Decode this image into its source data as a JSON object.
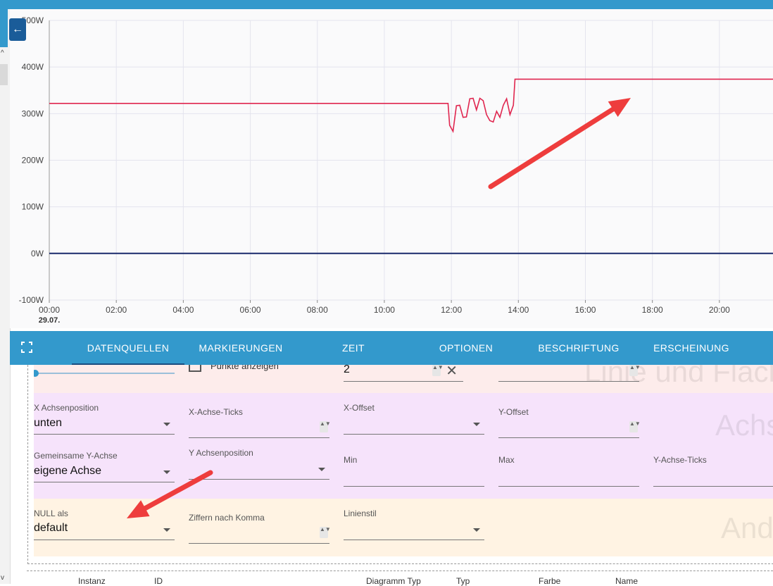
{
  "chart": {
    "y_tick_labels": [
      "500W",
      "400W",
      "300W",
      "200W",
      "100W",
      "0W",
      "-100W"
    ],
    "x_tick_labels": [
      "00:00",
      "02:00",
      "04:00",
      "06:00",
      "08:00",
      "10:00",
      "12:00",
      "14:00",
      "16:00",
      "18:00",
      "20:00"
    ],
    "date_label": "29.07.",
    "series_colors": {
      "power": "#e0264f",
      "zero": "#1a2a6c"
    },
    "annotation_color": "#ee3d3d"
  },
  "chart_data": {
    "type": "line",
    "ylim": [
      -100,
      500
    ],
    "x_unit": "hours since 00:00 on 29.07.",
    "xlim": [
      0,
      21.6
    ],
    "series": [
      {
        "values_x": [
          0,
          11.9,
          11.95,
          12.05,
          12.15,
          12.25,
          12.35,
          12.45,
          12.55,
          12.65,
          12.75,
          12.85,
          12.95,
          13.05,
          13.15,
          13.25,
          13.35,
          13.45,
          13.55,
          13.65,
          13.75,
          13.85,
          13.9,
          21.6
        ],
        "values_y": [
          322,
          322,
          275,
          262,
          317,
          318,
          292,
          293,
          332,
          333,
          308,
          333,
          328,
          298,
          285,
          282,
          305,
          292,
          318,
          332,
          298,
          318,
          374,
          374
        ]
      },
      {
        "values_x": [
          0,
          21.6
        ],
        "values_y": [
          0,
          0
        ]
      }
    ]
  },
  "toolbar": {
    "back_icon": "arrow-left-icon",
    "fullscreen_icon": "fullscreen-icon",
    "tabs": [
      "DATENQUELLEN",
      "MARKIERUNGEN",
      "ZEIT",
      "OPTIONEN",
      "BESCHRIFTUNG",
      "ERSCHEINUNG"
    ]
  },
  "form": {
    "row1": {
      "checkbox_label": "Punkte anzeigen",
      "number_value": "2",
      "section_title": "Linie und Fläche"
    },
    "achse": {
      "section_title": "Achse",
      "x_pos_label": "X Achsenposition",
      "x_pos_value": "unten",
      "x_ticks_label": "X-Achse-Ticks",
      "x_offset_label": "X-Offset",
      "y_offset_label": "Y-Offset",
      "common_y_label": "Gemeinsame Y-Achse",
      "common_y_value": "eigene Achse",
      "y_pos_label": "Y Achsenposition",
      "min_label": "Min",
      "max_label": "Max",
      "y_ticks_label": "Y-Achse-Ticks"
    },
    "andere": {
      "section_title": "And",
      "null_label": "NULL als",
      "null_value": "default",
      "digits_label": "Ziffern nach Komma",
      "line_style_label": "Linienstil"
    }
  },
  "table": {
    "headers": [
      "Instanz",
      "ID",
      "Diagramm Typ",
      "Typ",
      "Farbe",
      "Name"
    ]
  }
}
